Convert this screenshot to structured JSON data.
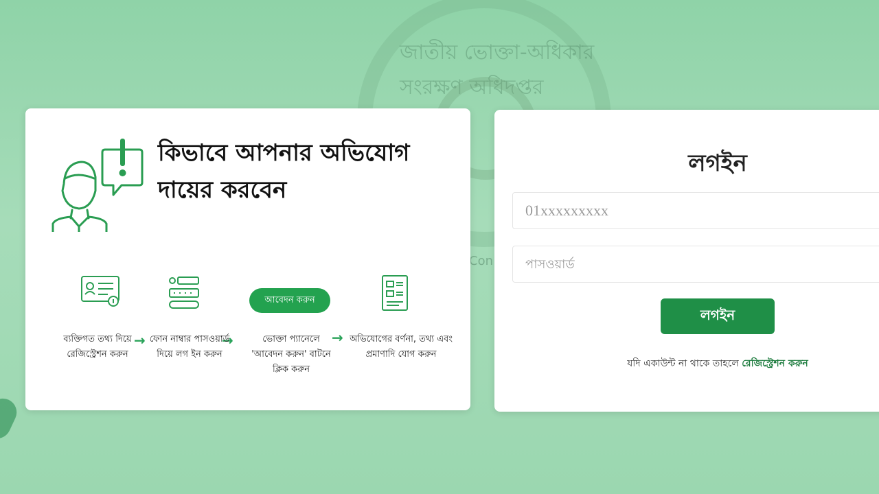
{
  "background": {
    "emblem_text": "জাতীয় ভোক্তা-অধিকার সংরক্ষণ অধিদপ্তর",
    "emblem_subtext": "Con"
  },
  "guide": {
    "title": "কিভাবে আপনার অভিযোগ দায়ের করবেন",
    "steps": [
      {
        "icon": "id-card-icon",
        "text": "ব্যক্তিগত তথ্য দিয়ে রেজিস্ট্রেশন করুন"
      },
      {
        "icon": "phone-password-icon",
        "text": "ফোন নাম্বার পাসওয়ার্ড দিয়ে লগ ইন করুন"
      },
      {
        "icon": "apply-button",
        "text": "ভোক্তা প্যানেলে 'আবেদন করুন' বাটনে ক্লিক করুন",
        "button_label": "আবেদন করুন"
      },
      {
        "icon": "document-form-icon",
        "text": "অভিযোগের বর্ণনা, তথ্য এবং প্রমাণাদি যোগ করুন"
      }
    ]
  },
  "login": {
    "title": "লগইন",
    "phone_placeholder": "01xxxxxxxxx",
    "password_placeholder": "পাসওয়ার্ড",
    "button_label": "লগইন",
    "register_prompt": "যদি একাউন্ট না থাকে তাহলে",
    "register_link": "রেজিস্ট্রেশন করুন"
  },
  "colors": {
    "accent": "#23a24f",
    "button": "#1f8f47",
    "background": "#9bd7b0"
  }
}
